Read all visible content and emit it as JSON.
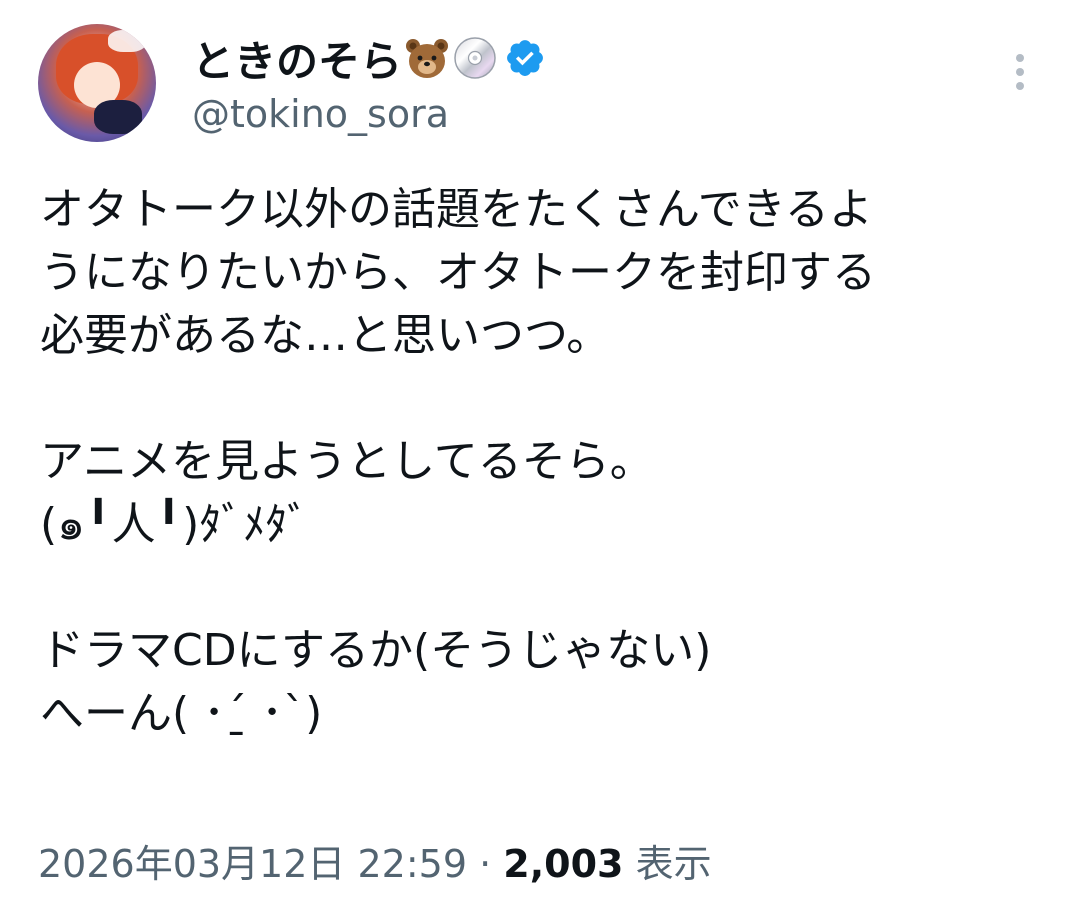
{
  "author": {
    "display_name": "ときのそら",
    "name_emojis": [
      "bear-face-emoji",
      "optical-disc-emoji"
    ],
    "handle": "@tokino_sora",
    "verified": true
  },
  "tweet": {
    "text": "オタトーク以外の話題をたくさんできるようになりたいから、オタトークを封印する必要があるな…と思いつつ。\n\nアニメを見ようとしてるそら。\n(๑╹人╹)ﾀﾞﾒﾀﾞ\n\nドラマCDにするか(そうじゃない)\nへーん( ･ˊ̱ ･ˋ)",
    "lines": [
      "オタトーク以外の話題をたくさんできるよ",
      "うになりたいから、オタトークを封印する",
      "必要があるな…と思いつつ。",
      "",
      "アニメを見ようとしてるそら。",
      "(๑╹人╹)ﾀﾞﾒﾀﾞ",
      "",
      "ドラマCDにするか(そうじゃない)",
      "へーん( ･ˊ̱ ･ˋ)"
    ],
    "timestamp": "2026年03月12日 22:59",
    "separator": "·",
    "views_count": "2,003",
    "views_label": "表示"
  },
  "colors": {
    "text_primary": "#0f1419",
    "text_secondary": "#536471",
    "verified_blue": "#1d9bf0"
  },
  "icons": {
    "more": "more-vertical-icon",
    "verified": "verified-badge-icon"
  }
}
